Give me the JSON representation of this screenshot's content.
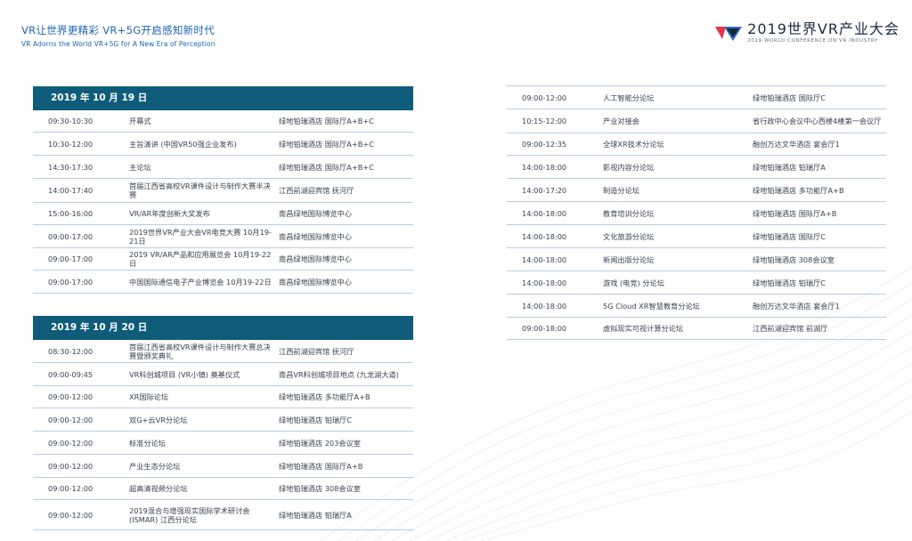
{
  "header": {
    "slogan_cn": "VR让世界更精彩  VR+5G开启感知新时代",
    "slogan_en": "VR Adorns the World   VR+5G for A New Era of Perception",
    "brand_title": "2019世界VR产业大会",
    "brand_sub": "2019 WORLD CONFERENCE ON VR INDUSTRY",
    "brand_colors": {
      "red": "#e8334a",
      "blue": "#2a6cc9",
      "navy": "#1b2940"
    }
  },
  "day1": {
    "title": "2019 年 10 月 19 日",
    "rows": [
      {
        "time": "09:30-10:30",
        "event": "开幕式",
        "venue": "绿地铂瑞酒店 国际厅A+B+C"
      },
      {
        "time": "10:30-12:00",
        "event": "主旨演讲 (中国VR50强企业发布)",
        "venue": "绿地铂瑞酒店 国际厅A+B+C"
      },
      {
        "time": "14:30-17:30",
        "event": "主论坛",
        "venue": "绿地铂瑞酒店 国际厅A+B+C"
      },
      {
        "time": "14:00-17:40",
        "event": "首届江西省高校VR课件设计与制作大赛半决赛",
        "venue": "江西前湖迎宾馆 抚河厅"
      },
      {
        "time": "15:00-16:00",
        "event": "VR/AR年度创新大奖发布",
        "venue": "南昌绿地国际博览中心"
      },
      {
        "time": "09:00-17:00",
        "event": "2019世界VR产业大会VR电竞大赛 10月19-21日",
        "venue": "南昌绿地国际博览中心"
      },
      {
        "time": "09:00-17:00",
        "event": "2019 VR/AR产品和应用展览会 10月19-22日",
        "venue": "南昌绿地国际博览中心"
      },
      {
        "time": "09:00-17:00",
        "event": "中国国际通信电子产业博览会 10月19-22日",
        "venue": "南昌绿地国际博览中心"
      }
    ]
  },
  "day2": {
    "title": "2019 年 10 月 20 日",
    "rows": [
      {
        "time": "08:30-12:00",
        "event": "首届江西省高校VR课件设计与制作大赛总决赛暨颁奖典礼",
        "venue": "江西前湖迎宾馆 抚河厅"
      },
      {
        "time": "09:00-09:45",
        "event": "VR科创城项目 (VR小镇) 奠基仪式",
        "venue": "南昌VR科创城项目地点 (九龙湖大道)"
      },
      {
        "time": "09:00-12:00",
        "event": "XR国际论坛",
        "venue": "绿地铂瑞酒店 多功能厅A+B"
      },
      {
        "time": "09:00-12:00",
        "event": "双G+云VR分论坛",
        "venue": "绿地铂瑞酒店 铂瑞厅C"
      },
      {
        "time": "09:00-12:00",
        "event": "标准分论坛",
        "venue": "绿地铂瑞酒店 203会议室"
      },
      {
        "time": "09:00-12:00",
        "event": "产业生态分论坛",
        "venue": "绿地铂瑞酒店 国际厅A+B"
      },
      {
        "time": "09:00-12:00",
        "event": "超高清视频分论坛",
        "venue": "绿地铂瑞酒店 308会议室"
      },
      {
        "time": "09:00-12:00",
        "event": "2019混合与增强现实国际学术研讨会 (ISMAR) 江西分论坛",
        "venue": "绿地铂瑞酒店 铂瑞厅A"
      }
    ]
  },
  "day2_cont": {
    "rows": [
      {
        "time": "09:00-12:00",
        "event": "人工智能分论坛",
        "venue": "绿地铂瑞酒店 国际厅C"
      },
      {
        "time": "10:15-12:00",
        "event": "产业对接会",
        "venue": "省行政中心会议中心西楼4楼第一会议厅"
      },
      {
        "time": "09:00-12:35",
        "event": "全球XR技术分论坛",
        "venue": "融创万达文华酒店 宴会厅1"
      },
      {
        "time": "14:00-18:00",
        "event": "影视内容分论坛",
        "venue": "绿地铂瑞酒店 铂瑞厅A"
      },
      {
        "time": "14:00-17:20",
        "event": "制造分论坛",
        "venue": "绿地铂瑞酒店 多功能厅A+B"
      },
      {
        "time": "14:00-18:00",
        "event": "教育培训分论坛",
        "venue": "绿地铂瑞酒店 国际厅A+B"
      },
      {
        "time": "14:00-18:00",
        "event": "文化旅游分论坛",
        "venue": "绿地铂瑞酒店 国际厅C"
      },
      {
        "time": "14:00-18:00",
        "event": "新闻出版分论坛",
        "venue": "绿地铂瑞酒店 308会议室"
      },
      {
        "time": "14:00-18:00",
        "event": "游戏 (电竞) 分论坛",
        "venue": "绿地铂瑞酒店 铂瑞厅C"
      },
      {
        "time": "14:00-18:00",
        "event": "5G Cloud XR智慧教育分论坛",
        "venue": "融创万达文华酒店 宴会厅1"
      },
      {
        "time": "09:00-18:00",
        "event": "虚拟现实可视计算分论坛",
        "venue": "江西前湖迎宾馆 前湖厅"
      }
    ]
  }
}
